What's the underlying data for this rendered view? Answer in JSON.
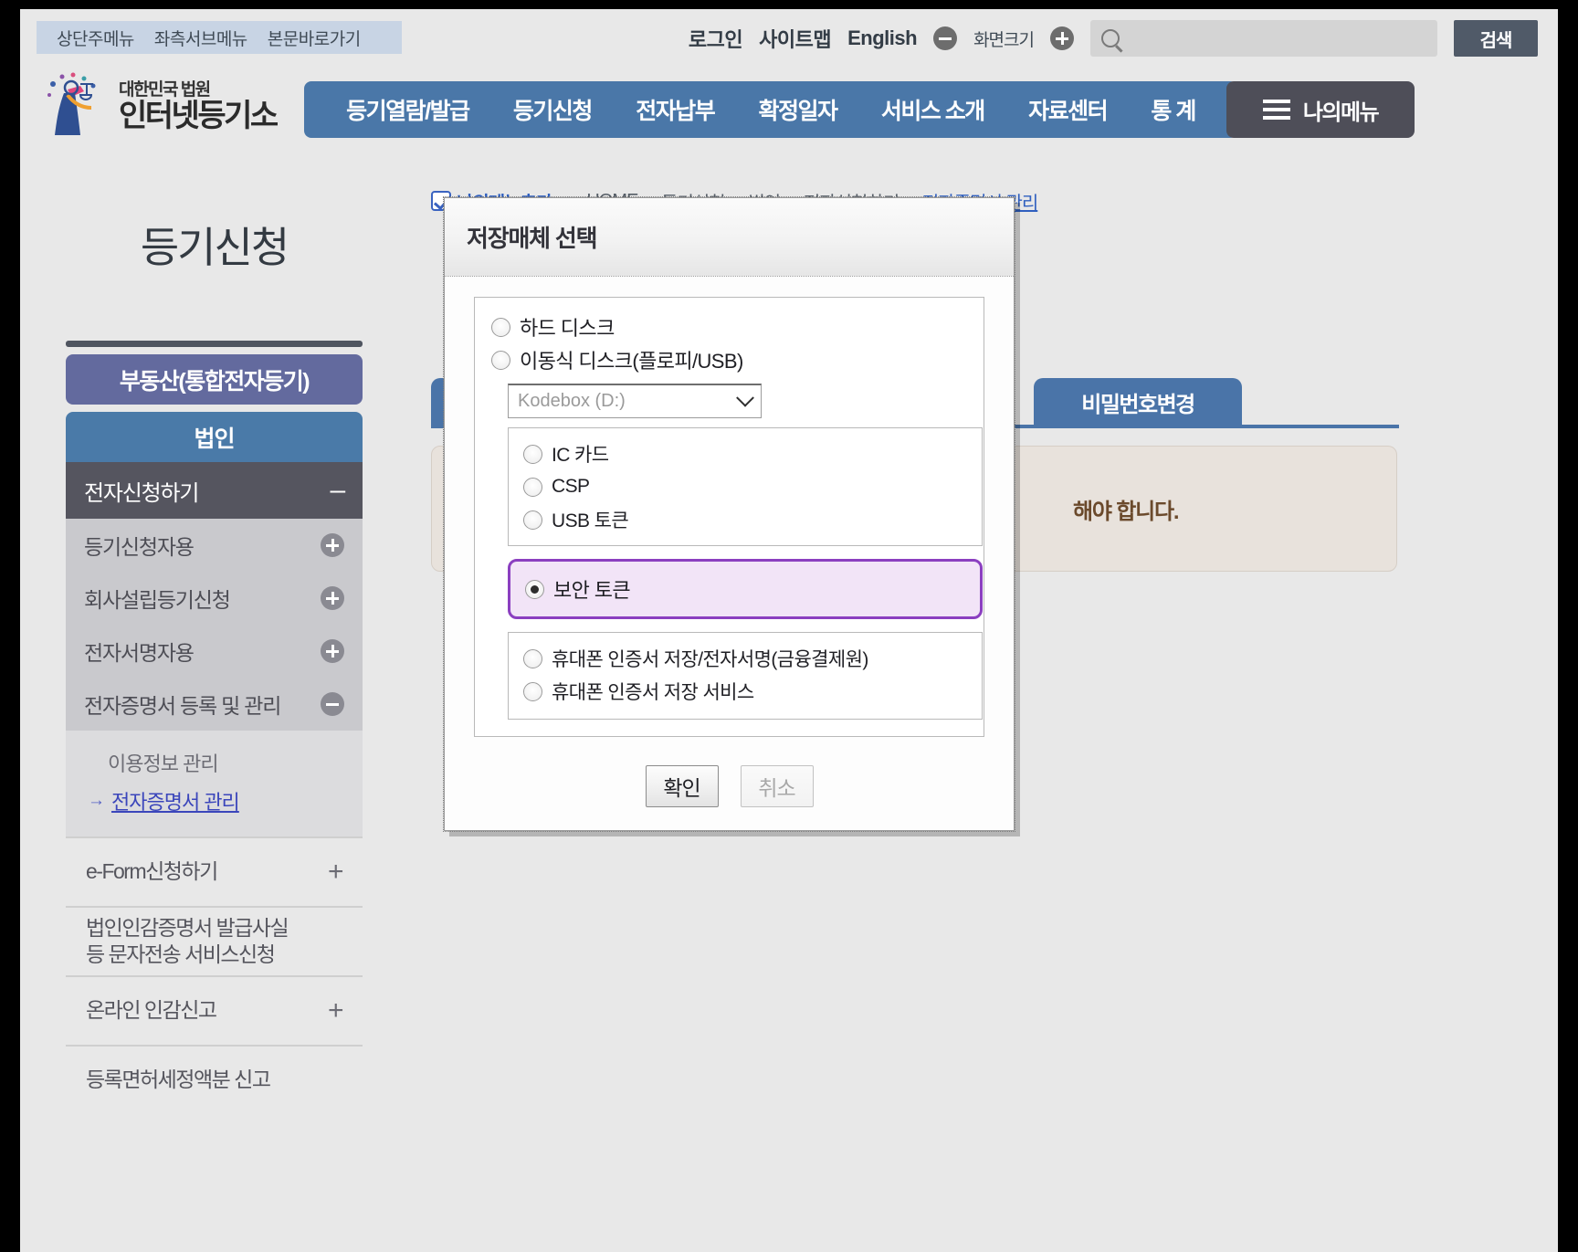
{
  "utility": {
    "links": [
      "상단주메뉴",
      "좌측서브메뉴",
      "본문바로가기"
    ]
  },
  "topbar": {
    "login": "로그인",
    "sitemap": "사이트맵",
    "english": "English",
    "fontsize_label": "화면크기",
    "search_value": "",
    "search_placeholder": "",
    "search_button": "검색"
  },
  "logo": {
    "sub": "대한민국 법원",
    "main": "인터넷등기소"
  },
  "mainnav": {
    "items": [
      "등기열람/발급",
      "등기신청",
      "전자납부",
      "확정일자",
      "서비스 소개",
      "자료센터",
      "통 계"
    ],
    "mymenu": "나의메뉴"
  },
  "sidebar": {
    "title": "등기신청",
    "primary_button": "부동산(통합전자등기)",
    "secondary_button": "법인",
    "section_header": "전자신청하기",
    "section_header_toggle": "minus",
    "rows": [
      {
        "label": "등기신청자용",
        "toggle": "plus"
      },
      {
        "label": "회사설립등기신청",
        "toggle": "plus"
      },
      {
        "label": "전자서명자용",
        "toggle": "plus"
      },
      {
        "label": "전자증명서 등록 및 관리",
        "toggle": "minus"
      }
    ],
    "subitems": [
      {
        "label": "이용정보 관리",
        "active": false
      },
      {
        "label": "전자증명서 관리",
        "active": true
      }
    ],
    "flat_items": [
      {
        "label": "e-Form신청하기",
        "toggle": "+",
        "lines": [
          "e-Form신청하기"
        ]
      },
      {
        "label": "법인인감증명서 발급사실 등 문자전송 서비스신청",
        "toggle": "",
        "lines": [
          "법인인감증명서 발급사실",
          "등 문자전송 서비스신청"
        ]
      },
      {
        "label": "온라인 인감신고",
        "toggle": "+",
        "lines": [
          "온라인 인감신고"
        ]
      },
      {
        "label": "등록면허세정액분 신고",
        "toggle": "",
        "lines": [
          "등록면허세정액분 신고"
        ]
      }
    ]
  },
  "content": {
    "mymenu_add": "나의메뉴추가",
    "breadcrumb": [
      "HOME",
      "등기신청",
      "법인",
      "전자신청하기",
      "전자증명서 관리"
    ],
    "tab_password": "비밀번호변경",
    "notice_text": "해야 합니다."
  },
  "modal": {
    "title": "저장매체 선택",
    "top_options": [
      {
        "label": "하드 디스크",
        "checked": false
      },
      {
        "label": "이동식 디스크(플로피/USB)",
        "checked": false
      }
    ],
    "drive_select_value": "Kodebox (D:)",
    "middle_options": [
      {
        "label": "IC 카드",
        "checked": false
      },
      {
        "label": "CSP",
        "checked": false
      },
      {
        "label": "USB 토큰",
        "checked": false
      }
    ],
    "highlight_option": {
      "label": "보안 토큰",
      "checked": true
    },
    "phone_options": [
      {
        "label": "휴대폰 인증서 저장/전자서명(금융결제원)",
        "checked": false
      },
      {
        "label": "휴대폰 인증서 저장 서비스",
        "checked": false
      }
    ],
    "confirm_button": "확인",
    "cancel_button": "취소",
    "cancel_disabled": true
  },
  "colors": {
    "nav_blue": "#4a77a8",
    "sidebar_purple": "#636a9e",
    "highlight_purple": "#8b3fc0",
    "highlight_bg": "#f2e4f7",
    "notice_bg": "#e8e2dc",
    "notice_text": "#6b4a2c"
  }
}
